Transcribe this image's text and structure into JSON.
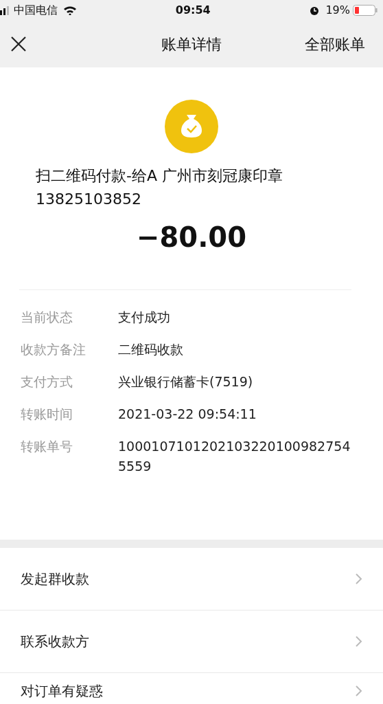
{
  "status_bar": {
    "carrier": "中国电信",
    "time": "09:54",
    "battery": "19%"
  },
  "nav": {
    "title": "账单详情",
    "right": "全部账单"
  },
  "summary": {
    "payee": "扫二维码付款-给A 广州市刻冠康印章13825103852",
    "amount": "−80.00"
  },
  "details": [
    {
      "label": "当前状态",
      "value": "支付成功"
    },
    {
      "label": "收款方备注",
      "value": "二维码收款"
    },
    {
      "label": "支付方式",
      "value": "兴业银行储蓄卡(7519)"
    },
    {
      "label": "转账时间",
      "value": "2021-03-22 09:54:11"
    },
    {
      "label": "转账单号",
      "value": "10001071012021032201009827545559"
    }
  ],
  "actions": [
    "发起群收款",
    "联系收款方",
    "对订单有疑惑"
  ]
}
